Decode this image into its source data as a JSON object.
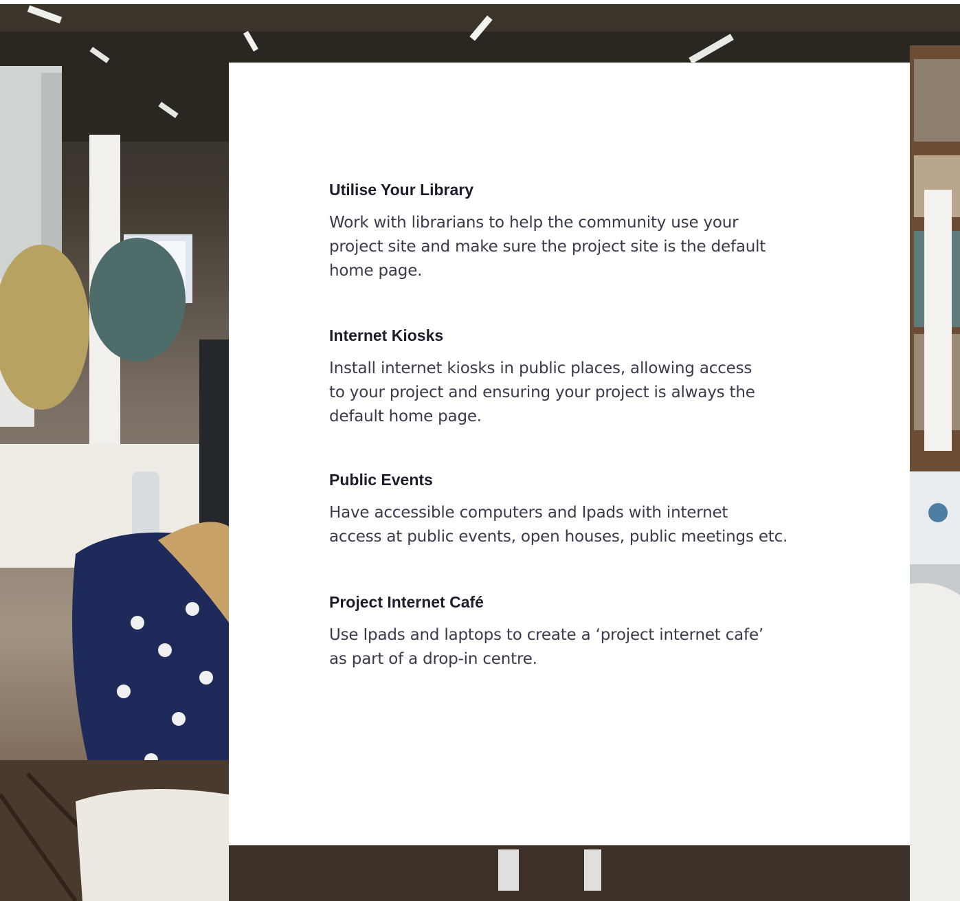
{
  "sections": [
    {
      "title": "Utilise Your Library",
      "body": "Work with librarians to help the community use your\nproject site and make sure the project site is the default\nhome page."
    },
    {
      "title": "Internet Kiosks",
      "body": "Install internet kiosks in public places, allowing access\nto your project and ensuring your project is always the\ndefault home page."
    },
    {
      "title": "Public Events",
      "body": "Have accessible computers and Ipads with internet\naccess at public events, open houses, public meetings etc."
    },
    {
      "title": "Project Internet Café",
      "body": "Use Ipads and laptops to create a ‘project  internet cafe’\nas part of a drop-in centre."
    }
  ],
  "colors": {
    "card_background": "#ffffff",
    "heading": "#1c1c2b",
    "body_text": "#3a3a4a"
  }
}
